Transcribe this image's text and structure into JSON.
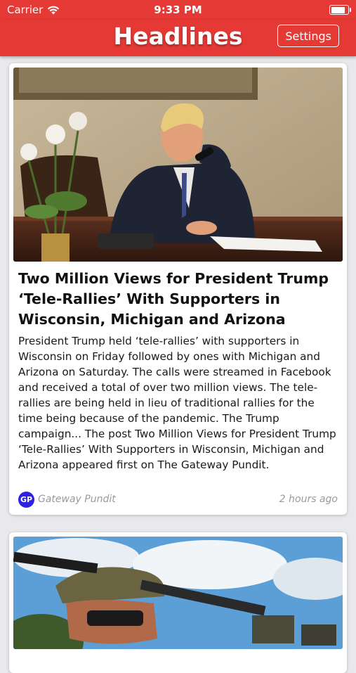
{
  "status_bar": {
    "carrier": "Carrier",
    "time": "9:33 PM"
  },
  "nav": {
    "title": "Headlines",
    "settings_label": "Settings",
    "accent_color": "#e53935"
  },
  "articles": [
    {
      "headline": "Two Million Views for President Trump ‘Tele-Rallies’ With Supporters in Wisconsin, Michigan and Arizona",
      "summary": "President Trump held ‘tele-rallies’ with supporters in Wisconsin on Friday followed by ones with Michigan and Arizona on Saturday. The calls were streamed in Facebook and received a total of over two million views. The tele-rallies are being held in lieu of traditional rallies for the time being because of the pandemic. The Trump campaign... The post Two Million Views for President Trump ‘Tele-Rallies’ With Supporters in Wisconsin, Michigan and Arizona appeared first on The Gateway Pundit.",
      "source_initials": "GP",
      "source_name": "Gateway Pundit",
      "time_ago": "2 hours ago"
    },
    {
      "image": "military-soldier-photo"
    }
  ]
}
